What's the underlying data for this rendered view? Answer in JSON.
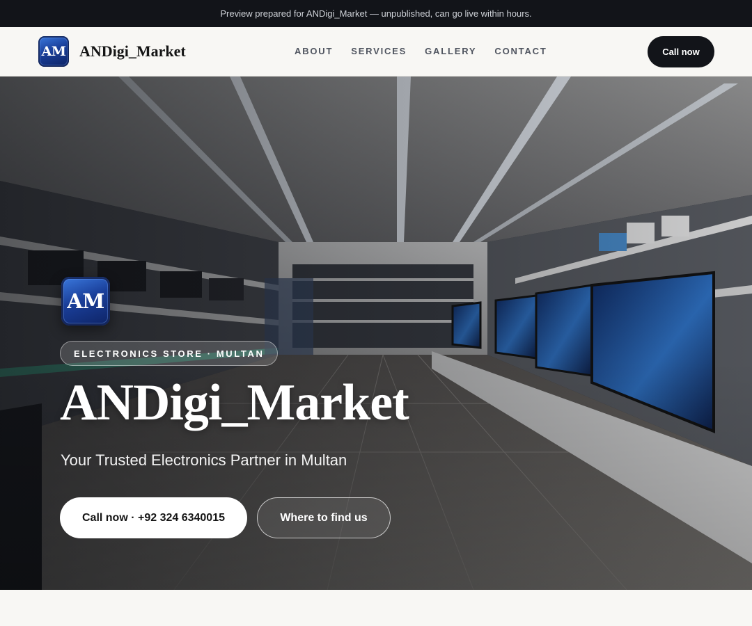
{
  "banner": {
    "text": "Preview prepared for ANDigi_Market — unpublished, can go live within hours."
  },
  "header": {
    "logo_text": "AM",
    "brand_name": "ANDigi_Market",
    "nav": [
      {
        "label": "ABOUT"
      },
      {
        "label": "SERVICES"
      },
      {
        "label": "GALLERY"
      },
      {
        "label": "CONTACT"
      }
    ],
    "cta_label": "Call now"
  },
  "hero": {
    "logo_text": "AM",
    "badge": "ELECTRONICS STORE · MULTAN",
    "title": "ANDigi_Market",
    "subtitle": "Your Trusted Electronics Partner in Multan",
    "primary_button": "Call now · +92 324 6340015",
    "secondary_button": "Where to find us",
    "background_image": "electronics-store-interior-photo"
  },
  "colors": {
    "banner_bg": "#121419",
    "page_bg": "#f8f7f4",
    "dark_button": "#121419",
    "logo_blue": "#1a3f9a"
  }
}
